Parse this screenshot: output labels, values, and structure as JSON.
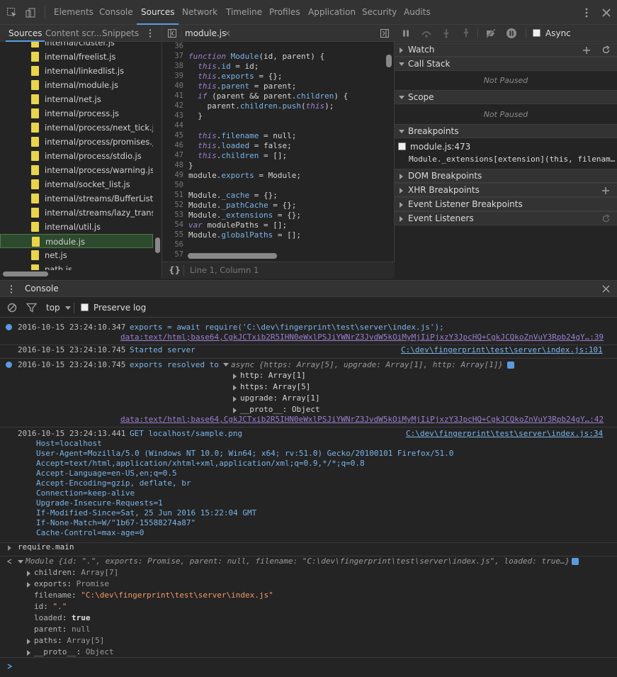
{
  "topbar": {
    "tabs": [
      "Elements",
      "Console",
      "Sources",
      "Network",
      "Timeline",
      "Profiles",
      "Application",
      "Security",
      "Audits"
    ],
    "active": "Sources"
  },
  "navigator": {
    "tabs": [
      "Sources",
      "Content scr...",
      "Snippets"
    ],
    "files": [
      "internal/cluster.js",
      "internal/freelist.js",
      "internal/linkedlist.js",
      "internal/module.js",
      "internal/net.js",
      "internal/process.js",
      "internal/process/next_tick.js",
      "internal/process/promises.js",
      "internal/process/stdio.js",
      "internal/process/warning.js",
      "internal/socket_list.js",
      "internal/streams/BufferList.js",
      "internal/streams/lazy_transfo",
      "internal/util.js",
      "module.js",
      "net.js",
      "path.js"
    ],
    "selected_index": 14
  },
  "editor": {
    "tab_label": "module.js",
    "close_glyph": "×",
    "first_line": 36,
    "status": "Line 1, Column 1",
    "braces": "{}"
  },
  "debugger": {
    "async_label": "Async",
    "watch": "Watch",
    "call_stack": "Call Stack",
    "not_paused": "Not Paused",
    "scope": "Scope",
    "breakpoints": "Breakpoints",
    "bp_location": "module.js:473",
    "bp_code": "Module._extensions[extension](this, filenam…",
    "dom_bp": "DOM Breakpoints",
    "xhr_bp": "XHR Breakpoints",
    "evt_bp": "Event Listener Breakpoints",
    "evt_listeners": "Event Listeners"
  },
  "drawer": {
    "title": "Console",
    "context": "top",
    "preserve_log": "Preserve log"
  },
  "console": {
    "l1_ts": "2016-10-15 23:24:10.347",
    "l1_msg": "exports = await require('C:\\dev\\fingerprint\\test\\server\\index.js');",
    "l1_src": "data:text/html;base64,CgkJCTxib2R5IHN0eWxlPSJiYWNrZ3JvdW5kOiMyMjIiPjxzY3JpcHQ+CgkJCQkoZnVuY3Rpb24gY…:39",
    "l2_ts": "2016-10-15 23:24:10.745",
    "l2_msg": "Started server",
    "l2_src": "C:\\dev\\fingerprint\\test\\server\\index.js:101",
    "l3_ts": "2016-10-15 23:24:10.745",
    "l3_msg": "exports resolved to",
    "l3_obj": "async {https: Array[5], upgrade: Array[1], http: Array[1]}",
    "l3_props": [
      "http: Array[1]",
      "https: Array[5]",
      "upgrade: Array[1]",
      "__proto__: Object"
    ],
    "l3_src": "data:text/html;base64,CgkJCTxib2R5IHN0eWxlPSJiYWNrZ3JvdW5kOiMyMjIiPjxzY3JpcHQ+CgkJCQkoZnVuY3Rpb24gY…:42",
    "l4_ts": "2016-10-15 23:24:13.441",
    "l4_msg": "GET localhost/sample.png",
    "l4_src": "C:\\dev\\fingerprint\\test\\server\\index.js:34",
    "l4_headers": [
      "Host=localhost",
      "User-Agent=Mozilla/5.0 (Windows NT 10.0; Win64; x64; rv:51.0) Gecko/20100101 Firefox/51.0",
      "Accept=text/html,application/xhtml+xml,application/xml;q=0.9,*/*;q=0.8",
      "Accept-Language=en-US,en;q=0.5",
      "Accept-Encoding=gzip, deflate, br",
      "Connection=keep-alive",
      "Upgrade-Insecure-Requests=1",
      "If-Modified-Since=Sat, 25 Jun 2016 15:22:04 GMT",
      "If-None-Match=W/\"1b67-15588274a87\"",
      "Cache-Control=max-age=0"
    ],
    "input1": "require.main",
    "result_summary": "Module {id: \".\", exports: Promise, parent: null, filename: \"C:\\dev\\fingerprint\\test\\server\\index.js\", loaded: true…}",
    "result_props": [
      {
        "k": "children",
        "v": "Array[7]",
        "expand": true
      },
      {
        "k": "exports",
        "v": "Promise",
        "expand": true
      },
      {
        "k": "filename",
        "v": "\"C:\\dev\\fingerprint\\test\\server\\index.js\"",
        "expand": false
      },
      {
        "k": "id",
        "v": "\".\"",
        "expand": false
      },
      {
        "k": "loaded",
        "v": "true",
        "expand": false
      },
      {
        "k": "parent",
        "v": "null",
        "expand": false
      },
      {
        "k": "paths",
        "v": "Array[5]",
        "expand": true
      },
      {
        "k": "__proto__",
        "v": "Object",
        "expand": true
      }
    ]
  },
  "colors": {
    "accent": "#5a9be0",
    "bg": "#242424",
    "panel": "#333333",
    "js_icon": "#e8d44d"
  }
}
